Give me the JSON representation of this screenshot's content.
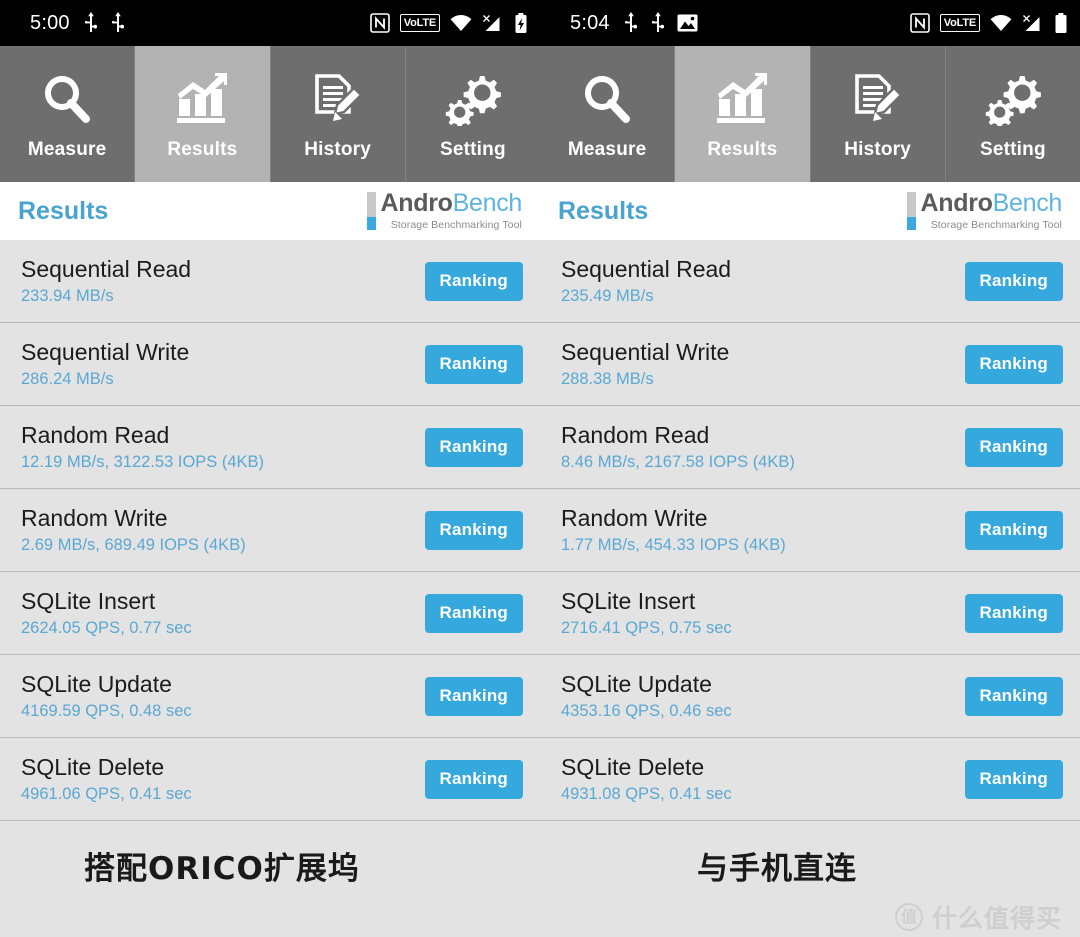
{
  "panels": [
    {
      "statusbar": {
        "time": "5:00",
        "left_icons": [
          "usb-icon",
          "usb-icon"
        ],
        "right_icons": [
          "nfc-icon",
          "volte-badge",
          "wifi-icon",
          "signal-no-service-icon",
          "battery-charging-icon"
        ],
        "volte_label": "VoLTE"
      },
      "tabs": [
        {
          "label": "Measure",
          "icon": "magnifier-icon",
          "active": false
        },
        {
          "label": "Results",
          "icon": "bar-chart-icon",
          "active": true
        },
        {
          "label": "History",
          "icon": "document-pencil-icon",
          "active": false
        },
        {
          "label": "Setting",
          "icon": "gears-icon",
          "active": false
        }
      ],
      "header": {
        "title": "Results",
        "logo_primary": "Andro",
        "logo_secondary": "Bench",
        "logo_subtitle": "Storage Benchmarking Tool"
      },
      "rows": [
        {
          "title": "Sequential Read",
          "value": "233.94 MB/s",
          "button": "Ranking"
        },
        {
          "title": "Sequential Write",
          "value": "286.24 MB/s",
          "button": "Ranking"
        },
        {
          "title": "Random Read",
          "value": "12.19 MB/s, 3122.53 IOPS (4KB)",
          "button": "Ranking"
        },
        {
          "title": "Random Write",
          "value": "2.69 MB/s, 689.49 IOPS (4KB)",
          "button": "Ranking"
        },
        {
          "title": "SQLite Insert",
          "value": "2624.05 QPS, 0.77 sec",
          "button": "Ranking"
        },
        {
          "title": "SQLite Update",
          "value": "4169.59 QPS, 0.48 sec",
          "button": "Ranking"
        },
        {
          "title": "SQLite Delete",
          "value": "4961.06 QPS, 0.41 sec",
          "button": "Ranking"
        }
      ],
      "caption": "搭配ORICO扩展坞"
    },
    {
      "statusbar": {
        "time": "5:04",
        "left_icons": [
          "usb-icon",
          "usb-icon",
          "image-icon"
        ],
        "right_icons": [
          "nfc-icon",
          "volte-badge",
          "wifi-icon",
          "signal-no-service-icon",
          "battery-icon"
        ],
        "volte_label": "VoLTE"
      },
      "tabs": [
        {
          "label": "Measure",
          "icon": "magnifier-icon",
          "active": false
        },
        {
          "label": "Results",
          "icon": "bar-chart-icon",
          "active": true
        },
        {
          "label": "History",
          "icon": "document-pencil-icon",
          "active": false
        },
        {
          "label": "Setting",
          "icon": "gears-icon",
          "active": false
        }
      ],
      "header": {
        "title": "Results",
        "logo_primary": "Andro",
        "logo_secondary": "Bench",
        "logo_subtitle": "Storage Benchmarking Tool"
      },
      "rows": [
        {
          "title": "Sequential Read",
          "value": "235.49 MB/s",
          "button": "Ranking"
        },
        {
          "title": "Sequential Write",
          "value": "288.38 MB/s",
          "button": "Ranking"
        },
        {
          "title": "Random Read",
          "value": "8.46 MB/s, 2167.58 IOPS (4KB)",
          "button": "Ranking"
        },
        {
          "title": "Random Write",
          "value": "1.77 MB/s, 454.33 IOPS (4KB)",
          "button": "Ranking"
        },
        {
          "title": "SQLite Insert",
          "value": "2716.41 QPS, 0.75 sec",
          "button": "Ranking"
        },
        {
          "title": "SQLite Update",
          "value": "4353.16 QPS, 0.46 sec",
          "button": "Ranking"
        },
        {
          "title": "SQLite Delete",
          "value": "4931.08 QPS, 0.41 sec",
          "button": "Ranking"
        }
      ],
      "caption": "与手机直连"
    }
  ],
  "watermark": {
    "logo_char": "值",
    "text": "什么值得买"
  },
  "colors": {
    "accent_blue": "#35a8de",
    "title_blue": "#4aa3cd",
    "value_blue": "#5aa8d4",
    "tab_inactive": "#6e6e6e",
    "tab_active": "#b3b3b3",
    "row_bg": "#e3e3e3",
    "statusbar_bg": "#000000"
  }
}
